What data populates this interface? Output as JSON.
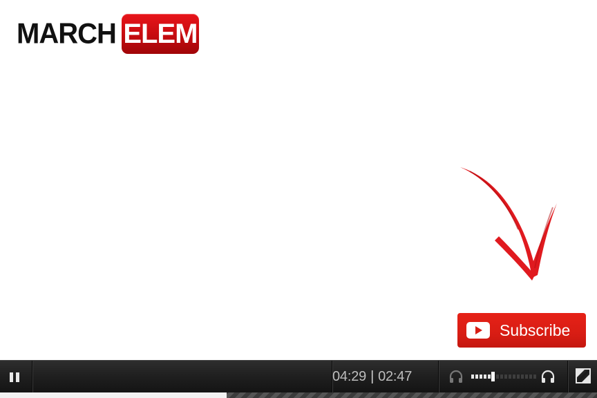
{
  "logo": {
    "part1": "MARCH",
    "part2": "ELEM"
  },
  "overlay": {
    "subscribe_label": "Subscribe",
    "arrow_icon": "red-down-arrow-icon",
    "accent_color": "#d81d14"
  },
  "player": {
    "current_time": "04:29",
    "time_separator": "|",
    "duration": "02:47",
    "progress_fraction": 0.38,
    "volume_fraction": 0.3,
    "controls": {
      "play_pause_icon": "pause-icon",
      "volume_down_icon": "headphones-icon",
      "volume_up_icon": "headphones-icon",
      "fullscreen_icon": "fullscreen-icon"
    }
  }
}
